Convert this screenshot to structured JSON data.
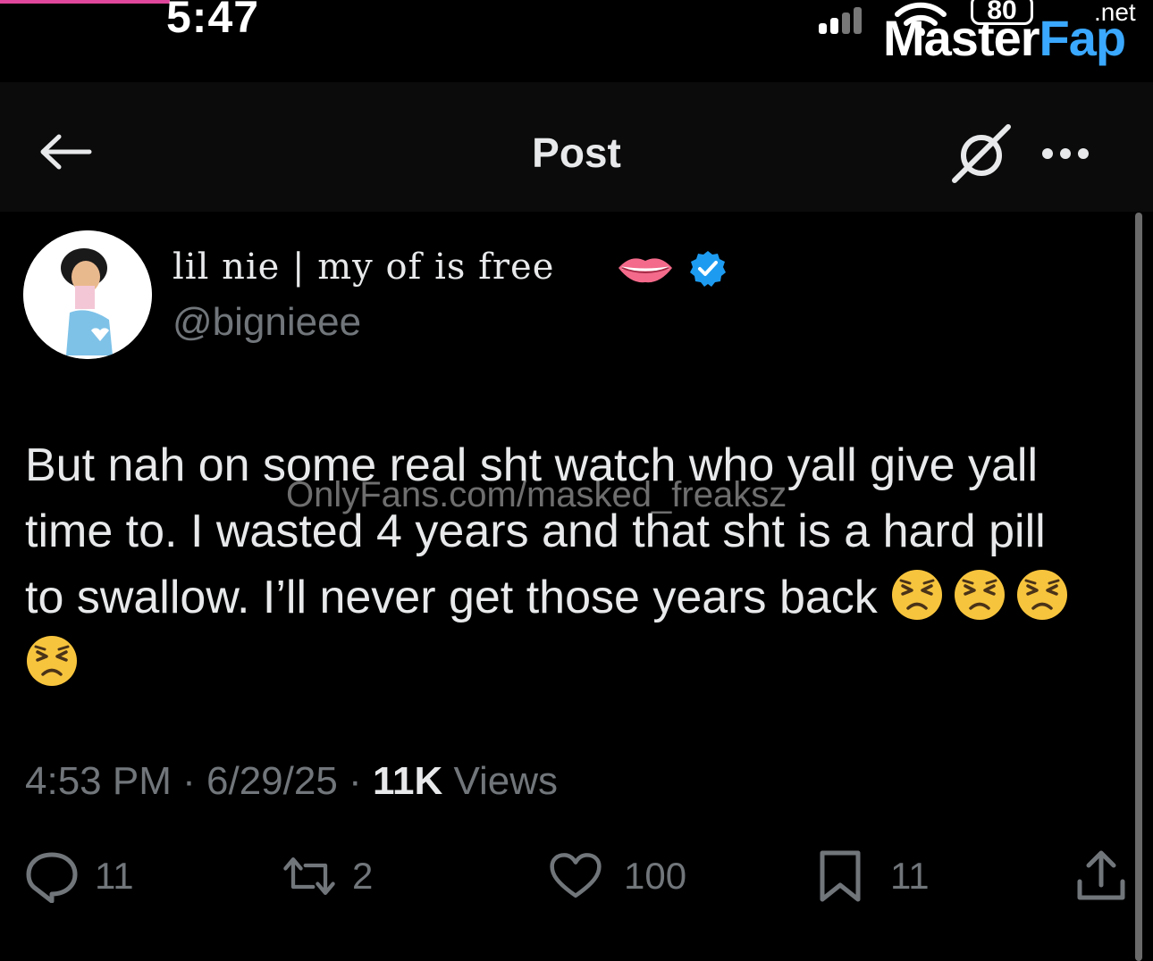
{
  "status_bar": {
    "time": "5:47",
    "battery": "80",
    "icons": [
      "signal-icon",
      "wifi-icon",
      "battery-icon"
    ]
  },
  "watermark": {
    "logo_master": "Master",
    "logo_fap": "Fap",
    "logo_net": ".net",
    "overlay_text": "OnlyFans.com/masked_freaksz"
  },
  "header": {
    "title": "Post",
    "icons": [
      "back-arrow-icon",
      "grok-icon",
      "more-icon"
    ]
  },
  "tweet": {
    "display_name": "lil nie | my of is free",
    "handle": "@bignieee",
    "verified": true,
    "name_emoji": "lips-icon",
    "lines": [
      "But nah on some real sht watch who yall give yall",
      "time to. I wasted 4 years and that sht is a hard pill",
      "to swallow. I’ll never get those years back"
    ],
    "emoji_name": "persevering-face-emoji",
    "emoji_count": 4,
    "time": "4:53 PM",
    "date": "6/29/25",
    "views_count": "11K",
    "views_label": "Views",
    "separator": "·"
  },
  "actions": {
    "replies": "11",
    "reposts": "2",
    "likes": "100",
    "bookmarks": "11"
  },
  "colors": {
    "background": "#000000",
    "text": "#e7e9ea",
    "secondary": "#71767b",
    "verified": "#1d9bf0",
    "brand_accent": "#3aa8ff"
  }
}
